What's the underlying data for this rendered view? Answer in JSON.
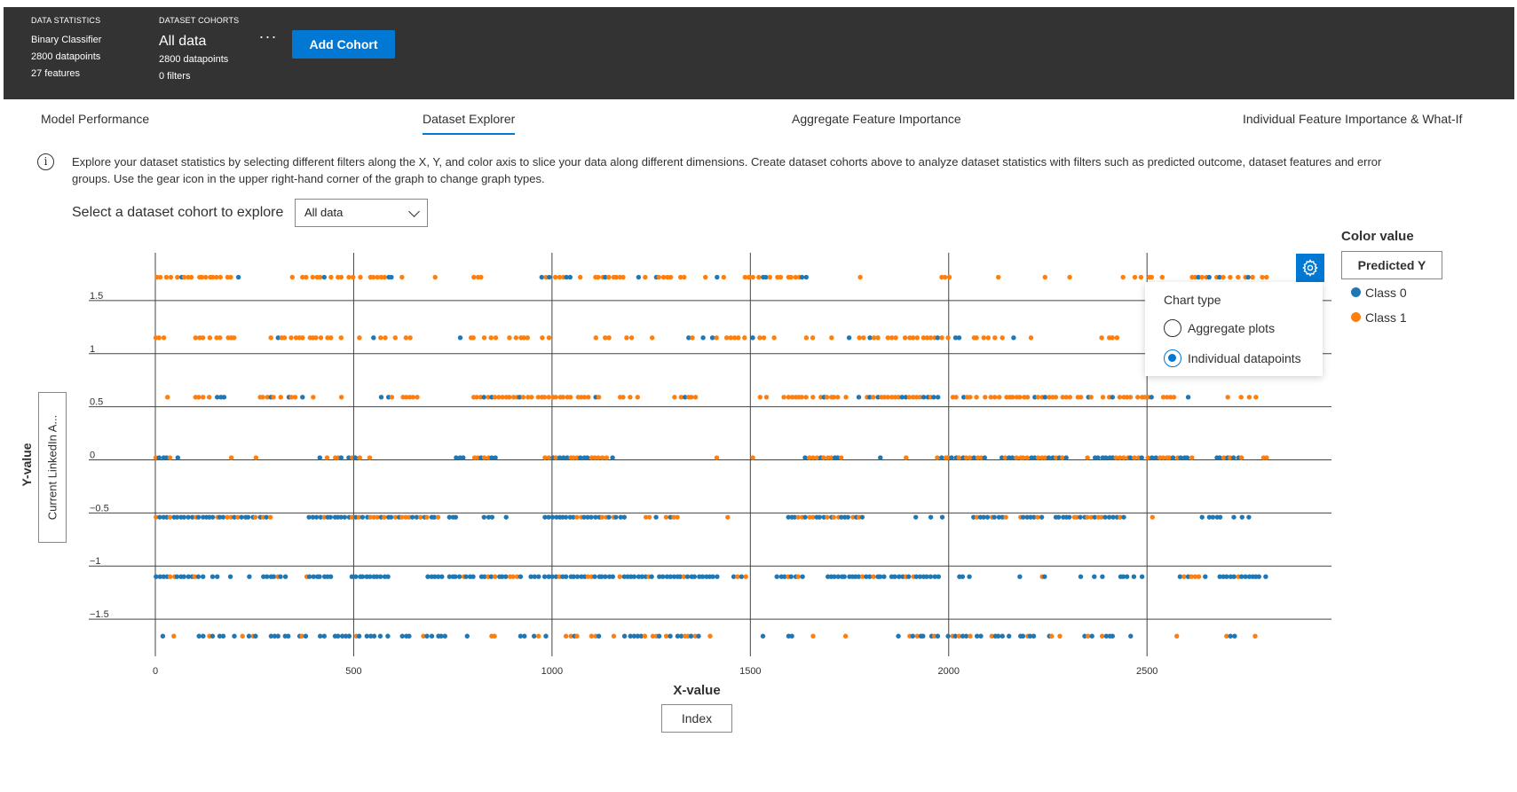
{
  "header": {
    "stats_title": "DATA STATISTICS",
    "stats_lines": [
      "Binary Classifier",
      "2800 datapoints",
      "27 features"
    ],
    "cohorts_title": "DATASET COHORTS",
    "cohort_name": "All data",
    "cohort_lines": [
      "2800 datapoints",
      "0 filters"
    ],
    "more_label": "···",
    "add_cohort_label": "Add Cohort"
  },
  "tabs": [
    {
      "label": "Model Performance",
      "active": false
    },
    {
      "label": "Dataset Explorer",
      "active": true
    },
    {
      "label": "Aggregate Feature Importance",
      "active": false
    },
    {
      "label": "Individual Feature Importance & What-If",
      "active": false
    }
  ],
  "info": {
    "icon": "info-icon",
    "text": "Explore your dataset statistics by selecting different filters along the X, Y, and color axis to slice your data along different dimensions. Create dataset cohorts above to analyze dataset statistics with filters such as predicted outcome, dataset features and error groups. Use the gear icon in the upper right-hand corner of the graph to change graph types."
  },
  "cohort_picker": {
    "label": "Select a dataset cohort to explore",
    "selected": "All data"
  },
  "axes": {
    "y_title": "Y-value",
    "y_feature_button": "Current LinkedIn A...",
    "x_title": "X-value",
    "x_feature_button": "Index"
  },
  "chart_type_menu": {
    "gear_icon": "gear-icon",
    "title": "Chart type",
    "options": [
      {
        "label": "Aggregate plots",
        "checked": false
      },
      {
        "label": "Individual datapoints",
        "checked": true
      }
    ]
  },
  "color_panel": {
    "title": "Color value",
    "button": "Predicted Y",
    "legend": [
      {
        "label": "Class 0",
        "color": "#1f77b4"
      },
      {
        "label": "Class 1",
        "color": "#ff7f0e"
      }
    ]
  },
  "chart_data": {
    "type": "scatter",
    "title": "",
    "xlabel": "X-value",
    "ylabel": "Y-value",
    "xlim": [
      0,
      2965
    ],
    "ylim": [
      -1.85,
      1.95
    ],
    "x_ticks": [
      0,
      500,
      1000,
      1500,
      2000,
      2500
    ],
    "y_ticks": [
      1.5,
      1,
      0.5,
      0,
      -0.5,
      -1,
      -1.5
    ],
    "y_tick_labels": [
      "1.5",
      "1",
      "0.5",
      "0",
      "−0.5",
      "−1",
      "−1.5"
    ],
    "x_tick_labels": [
      "0",
      "500",
      "1000",
      "1500",
      "2000",
      "2500"
    ],
    "grid": true,
    "n_points": 2800,
    "y_levels": [
      {
        "y": 1.72,
        "class1_share": 0.85,
        "density": 0.55
      },
      {
        "y": 1.15,
        "class1_share": 0.85,
        "density": 0.45
      },
      {
        "y": 0.59,
        "class1_share": 0.8,
        "density": 0.7
      },
      {
        "y": 0.02,
        "class1_share": 0.6,
        "density": 0.95
      },
      {
        "y": -0.54,
        "class1_share": 0.3,
        "density": 0.9
      },
      {
        "y": -1.1,
        "class1_share": 0.15,
        "density": 0.8
      },
      {
        "y": -1.66,
        "class1_share": 0.25,
        "density": 0.4
      }
    ],
    "series": [
      {
        "name": "Class 0",
        "color": "#1f77b4"
      },
      {
        "name": "Class 1",
        "color": "#ff7f0e"
      }
    ]
  }
}
